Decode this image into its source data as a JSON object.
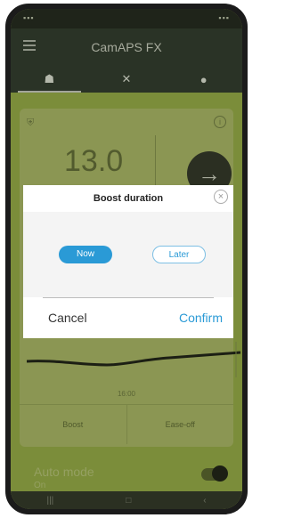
{
  "app": {
    "title": "CamAPS FX"
  },
  "tabs": [
    {
      "icon": "home-icon",
      "glyph": "☗"
    },
    {
      "icon": "tools-icon",
      "glyph": "✕"
    },
    {
      "icon": "drop-icon",
      "glyph": "●"
    }
  ],
  "card": {
    "glucose_value": "13.0",
    "time_label": "16:00",
    "buttons": {
      "boost": "Boost",
      "ease_off": "Ease-off"
    }
  },
  "auto_mode": {
    "label": "Auto mode",
    "status": "On",
    "enabled": true
  },
  "dialog": {
    "title": "Boost duration",
    "option_now": "Now",
    "option_later": "Later",
    "selected": "Now",
    "cancel_label": "Cancel",
    "confirm_label": "Confirm"
  },
  "colors": {
    "accent": "#2a9ad6",
    "app_bar": "#2a3326",
    "background": "#7b8d3a"
  }
}
